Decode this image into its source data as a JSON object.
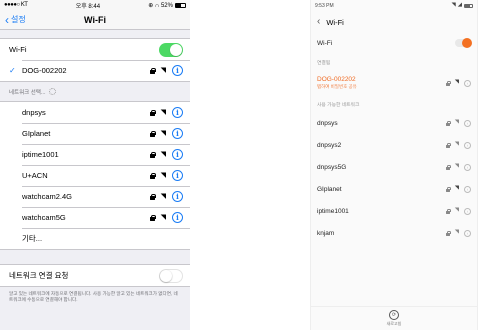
{
  "ios": {
    "status": {
      "carrier": "●●●●○ KT",
      "wifi_icon": "wifi-icon",
      "time": "오후 8:44",
      "indicators": "⊕ ∩ 52%"
    },
    "nav": {
      "back_label": "설정",
      "title": "Wi-Fi"
    },
    "wifi_toggle": {
      "label": "Wi-Fi",
      "on": true,
      "color": "#4cd964"
    },
    "connected": {
      "name": "DOG-002202",
      "checked": true
    },
    "networks_header": "네트워크 선택...",
    "networks": [
      {
        "name": "dnpsys"
      },
      {
        "name": "GIplanet"
      },
      {
        "name": "iptime1001"
      },
      {
        "name": "U+ACN"
      },
      {
        "name": "watchcam2.4G"
      },
      {
        "name": "watchcam5G"
      }
    ],
    "other_label": "기타...",
    "ask_join": {
      "label": "네트워크 연결 요청",
      "on": false
    },
    "footnote": "알고 있는 네트워크에 자동으로 연결됩니다. 사용 가능한 알고 있는 네트워크가 없다면, 네트워크에 수동으로 연결해야 합니다."
  },
  "android": {
    "status": {
      "time": "9:53 PM"
    },
    "header": {
      "back_icon": "chevron-left-icon",
      "title": "Wi-Fi"
    },
    "wifi_toggle": {
      "label": "Wi-Fi",
      "on": true,
      "color": "#f37021"
    },
    "connected_header": "연결됨",
    "connected": {
      "name": "DOG-002202",
      "sub": "탭하여 비밀번호 공유"
    },
    "available_header": "사용 가능한 네트워크",
    "networks": [
      {
        "name": "dnpsys"
      },
      {
        "name": "dnpsys2"
      },
      {
        "name": "dnpsys5G"
      },
      {
        "name": "GIplanet"
      },
      {
        "name": "iptime1001"
      },
      {
        "name": "knjam"
      }
    ],
    "refresh_label": "새로고침"
  }
}
